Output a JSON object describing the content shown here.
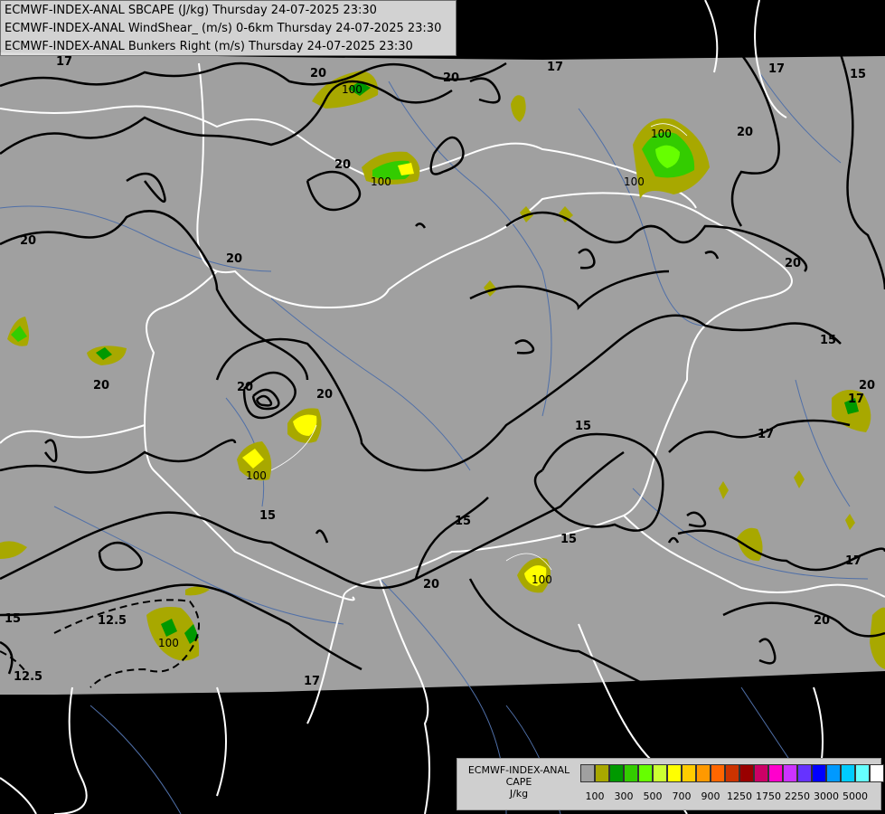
{
  "titles": [
    "ECMWF-INDEX-ANAL SBCAPE (J/kg) Thursday 24-07-2025 23:30",
    "ECMWF-INDEX-ANAL WindShear_ (m/s) 0-6km Thursday 24-07-2025 23:30",
    "ECMWF-INDEX-ANAL Bunkers Right (m/s) Thursday 24-07-2025 23:30"
  ],
  "legend": {
    "name_line1": "ECMWF-INDEX-ANAL",
    "name_line2": "CAPE",
    "name_line3": "J/kg",
    "colors": [
      "#a0a0a0",
      "#a8a800",
      "#009900",
      "#33cc00",
      "#66ff00",
      "#ccff33",
      "#ffff00",
      "#ffcc00",
      "#ff9900",
      "#ff6600",
      "#cc3300",
      "#990000",
      "#cc0066",
      "#ff00cc",
      "#cc33ff",
      "#6633ff",
      "#0000ff",
      "#0099ff",
      "#00ccff",
      "#66ffff",
      "#ffffff"
    ],
    "ticks": [
      "100",
      "300",
      "500",
      "700",
      "900",
      "1250",
      "1750",
      "2250",
      "3000",
      "5000"
    ]
  },
  "contour_labels": {
    "shear": [
      "17",
      "20",
      "20",
      "17",
      "17",
      "15",
      "20",
      "20",
      "20",
      "20",
      "20",
      "20",
      "20",
      "20",
      "15",
      "15",
      "17",
      "17",
      "20",
      "17",
      "15",
      "15",
      "15",
      "12.5",
      "12.5",
      "15",
      "17",
      "20",
      "20"
    ],
    "cape": [
      "100",
      "100",
      "100",
      "100",
      "100",
      "100",
      "100"
    ]
  }
}
